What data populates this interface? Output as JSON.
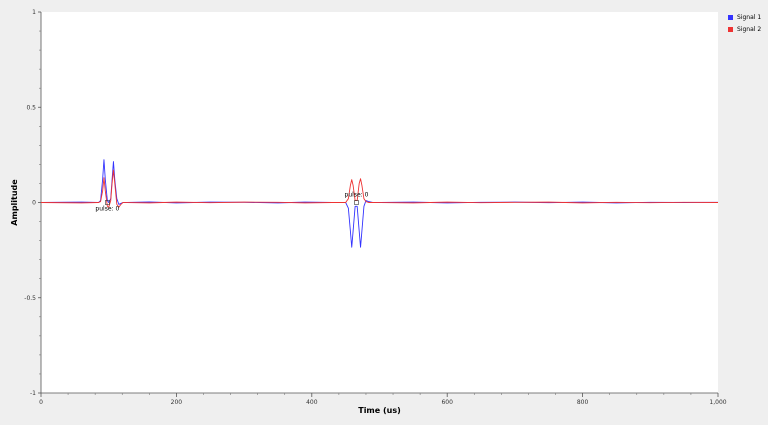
{
  "chart_data": {
    "type": "line",
    "xlabel": "Time (us)",
    "ylabel": "Amplitude",
    "xlim": [
      0,
      1000
    ],
    "ylim": [
      -1,
      1
    ],
    "xticks": [
      0,
      200,
      400,
      600,
      800,
      1000
    ],
    "xtick_labels": [
      "0",
      "200",
      "400",
      "600",
      "800",
      "1,000"
    ],
    "yticks": [
      1,
      0.5,
      0,
      -0.5,
      -1
    ],
    "ytick_labels": [
      "1",
      "0.5",
      "0",
      "-0.5",
      "-1"
    ],
    "grid": false,
    "legend_position": "right",
    "series": [
      {
        "name": "Signal 1",
        "color": "#3333ff",
        "points": [
          [
            0,
            0
          ],
          [
            60,
            0.002
          ],
          [
            85,
            0
          ],
          [
            88,
            0.01
          ],
          [
            91,
            0.12
          ],
          [
            93,
            0.225
          ],
          [
            95,
            0.12
          ],
          [
            98,
            0.01
          ],
          [
            100,
            0
          ],
          [
            103,
            0.02
          ],
          [
            105,
            0.12
          ],
          [
            107,
            0.215
          ],
          [
            109,
            0.12
          ],
          [
            112,
            0.02
          ],
          [
            115,
            -0.01
          ],
          [
            118,
            -0.005
          ],
          [
            121,
            0
          ],
          [
            160,
            0.003
          ],
          [
            200,
            -0.002
          ],
          [
            250,
            0.002
          ],
          [
            300,
            0.001
          ],
          [
            350,
            -0.002
          ],
          [
            390,
            0.002
          ],
          [
            430,
            0
          ],
          [
            450,
            0
          ],
          [
            454,
            -0.03
          ],
          [
            457,
            -0.15
          ],
          [
            459,
            -0.235
          ],
          [
            461,
            -0.15
          ],
          [
            464,
            -0.02
          ],
          [
            467,
            -0.02
          ],
          [
            470,
            -0.15
          ],
          [
            472,
            -0.235
          ],
          [
            474,
            -0.15
          ],
          [
            477,
            -0.02
          ],
          [
            480,
            0.01
          ],
          [
            484,
            0.005
          ],
          [
            490,
            0
          ],
          [
            550,
            0.002
          ],
          [
            600,
            -0.002
          ],
          [
            650,
            0.001
          ],
          [
            700,
            0.002
          ],
          [
            750,
            -0.001
          ],
          [
            800,
            0.002
          ],
          [
            850,
            -0.002
          ],
          [
            900,
            0.001
          ],
          [
            950,
            0
          ],
          [
            1000,
            0.001
          ]
        ]
      },
      {
        "name": "Signal 2",
        "color": "#ee3333",
        "points": [
          [
            0,
            0
          ],
          [
            60,
            -0.002
          ],
          [
            85,
            0
          ],
          [
            88,
            0.005
          ],
          [
            91,
            0.06
          ],
          [
            93,
            0.13
          ],
          [
            95,
            0.06
          ],
          [
            98,
            -0.02
          ],
          [
            100,
            -0.025
          ],
          [
            103,
            0.01
          ],
          [
            105,
            0.1
          ],
          [
            107,
            0.17
          ],
          [
            109,
            0.1
          ],
          [
            112,
            -0.01
          ],
          [
            115,
            -0.025
          ],
          [
            118,
            -0.01
          ],
          [
            121,
            0
          ],
          [
            160,
            -0.002
          ],
          [
            200,
            0.002
          ],
          [
            250,
            -0.001
          ],
          [
            300,
            0.002
          ],
          [
            350,
            0.001
          ],
          [
            390,
            -0.002
          ],
          [
            430,
            0
          ],
          [
            450,
            0
          ],
          [
            454,
            0.02
          ],
          [
            457,
            0.09
          ],
          [
            459,
            0.12
          ],
          [
            461,
            0.09
          ],
          [
            464,
            0.01
          ],
          [
            467,
            0.01
          ],
          [
            470,
            0.1
          ],
          [
            472,
            0.125
          ],
          [
            474,
            0.09
          ],
          [
            477,
            0.02
          ],
          [
            480,
            0.005
          ],
          [
            484,
            0
          ],
          [
            490,
            0
          ],
          [
            550,
            -0.002
          ],
          [
            600,
            0.002
          ],
          [
            650,
            -0.001
          ],
          [
            700,
            0.001
          ],
          [
            750,
            0.002
          ],
          [
            800,
            -0.002
          ],
          [
            850,
            0.001
          ],
          [
            900,
            -0.001
          ],
          [
            950,
            0.001
          ],
          [
            1000,
            0
          ]
        ]
      }
    ],
    "annotations": [
      {
        "text": "pulse: 0",
        "x": 98,
        "y": 0
      },
      {
        "text": "pulse: 0",
        "x": 466,
        "y": 0
      }
    ]
  }
}
